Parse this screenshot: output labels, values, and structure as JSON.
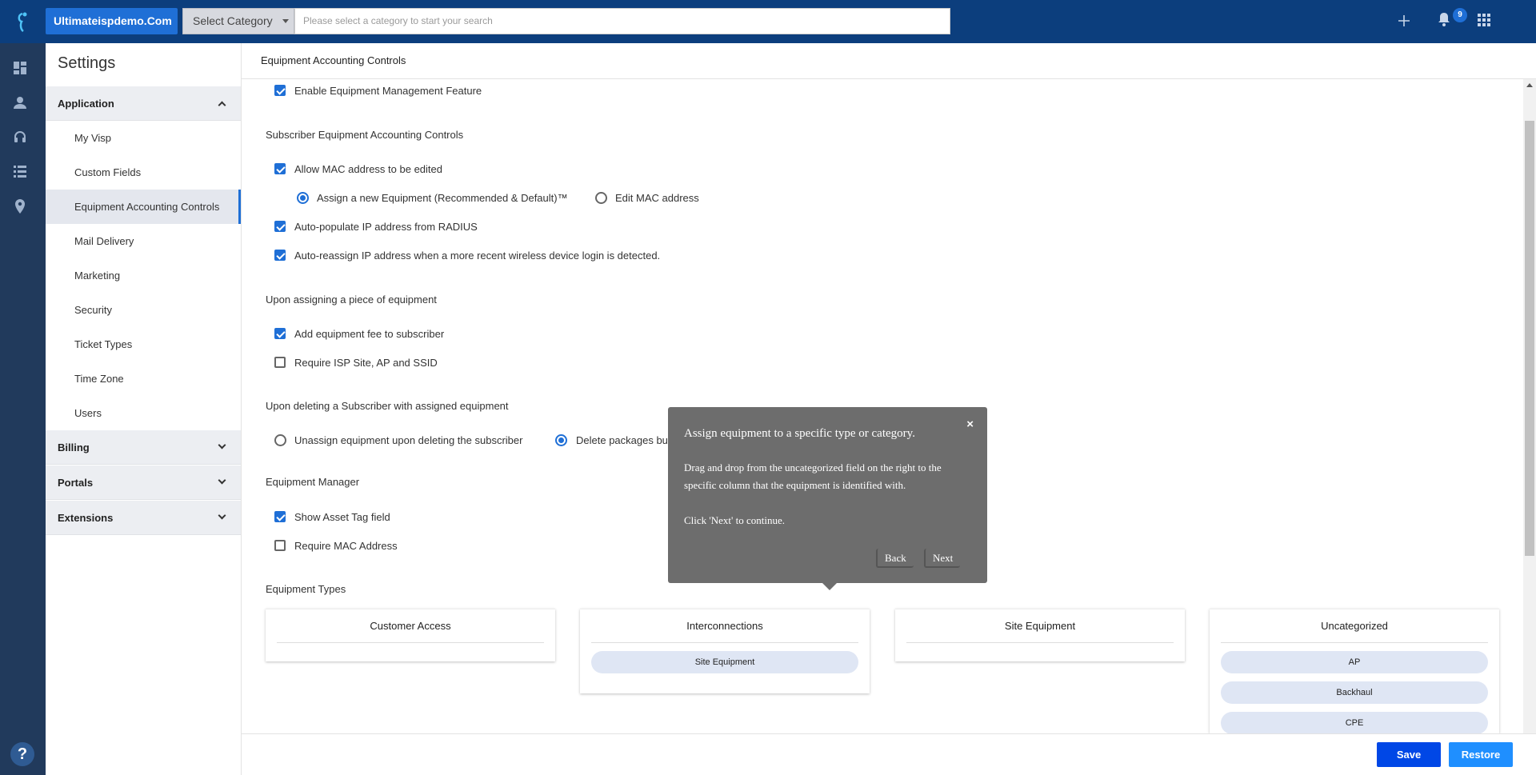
{
  "topbar": {
    "brand": "Ultimateispdemo.Com",
    "category_select": "Select Category",
    "search_placeholder": "Please select a category to start your search",
    "notification_count": "9"
  },
  "settings": {
    "title": "Settings",
    "groups": {
      "application": "Application",
      "billing": "Billing",
      "portals": "Portals",
      "extensions": "Extensions"
    },
    "items": [
      {
        "label": "My Visp"
      },
      {
        "label": "Custom Fields"
      },
      {
        "label": "Equipment Accounting Controls"
      },
      {
        "label": "Mail Delivery"
      },
      {
        "label": "Marketing"
      },
      {
        "label": "Security"
      },
      {
        "label": "Ticket Types"
      },
      {
        "label": "Time Zone"
      },
      {
        "label": "Users"
      }
    ]
  },
  "main": {
    "title": "Equipment Accounting Controls",
    "enable_feature": "Enable Equipment Management Feature",
    "sub_section": "Subscriber Equipment Accounting Controls",
    "allow_mac": "Allow MAC address to be edited",
    "radio_assign_new": "Assign a new Equipment (Recommended & Default)™",
    "radio_edit_mac": "Edit MAC address",
    "auto_populate_ip": "Auto-populate IP address from RADIUS",
    "auto_reassign_ip": "Auto-reassign IP address when a more recent wireless device login is detected.",
    "assign_section": "Upon assigning a piece of equipment",
    "add_fee": "Add equipment fee to subscriber",
    "require_isp": "Require ISP Site, AP and SSID",
    "delete_section": "Upon deleting a Subscriber with assigned equipment",
    "radio_unassign": "Unassign equipment upon deleting the subscriber",
    "radio_delete_packages": "Delete packages bu",
    "manager_section": "Equipment Manager",
    "show_asset_tag": "Show Asset Tag field",
    "require_mac": "Require MAC Address",
    "types_section": "Equipment Types",
    "type_cards": [
      {
        "title": "Customer Access",
        "chips": []
      },
      {
        "title": "Interconnections",
        "chips": [
          "Site Equipment"
        ]
      },
      {
        "title": "Site Equipment",
        "chips": []
      },
      {
        "title": "Uncategorized",
        "chips": [
          "AP",
          "Backhaul",
          "CPE"
        ]
      }
    ]
  },
  "tour": {
    "close": "×",
    "title": "Assign equipment to a specific type or category.",
    "body_line1": "Drag and drop from the uncategorized field on the right to the specific column that the equipment is identified with.",
    "body_line2": "Click 'Next' to continue.",
    "back": "Back",
    "next": "Next"
  },
  "footer": {
    "save": "Save",
    "restore": "Restore"
  },
  "colors": {
    "topbar": "#0c3e7d",
    "rail": "#213a5c",
    "accent": "#1f6fd6",
    "save_button": "#0047e6"
  },
  "icons": [
    "logo-icon",
    "add-icon",
    "bell-icon",
    "apps-grid-icon",
    "dashboard-icon",
    "user-icon",
    "headset-icon",
    "list-icon",
    "location-pin-icon",
    "help-icon"
  ]
}
